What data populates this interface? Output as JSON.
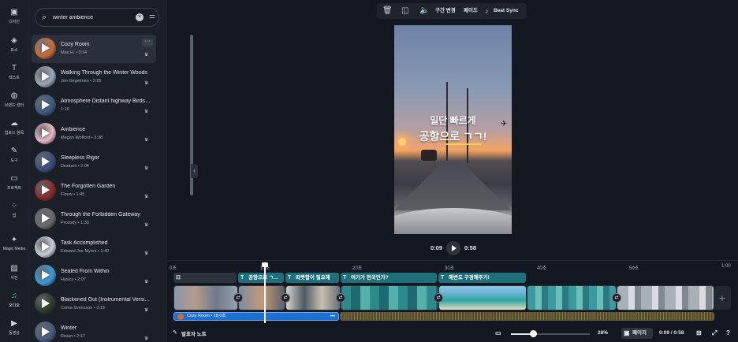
{
  "rail": [
    {
      "label": "디자인",
      "icon": "layout-icon"
    },
    {
      "label": "요소",
      "icon": "elements-icon"
    },
    {
      "label": "텍스트",
      "icon": "text-icon"
    },
    {
      "label": "브랜드 센터",
      "icon": "brand-icon"
    },
    {
      "label": "업로드 항목",
      "icon": "upload-icon"
    },
    {
      "label": "도구",
      "icon": "draw-icon"
    },
    {
      "label": "프로젝트",
      "icon": "folder-icon"
    },
    {
      "label": "앱",
      "icon": "apps-icon"
    },
    {
      "label": "Magic Media",
      "icon": "magic-media-icon"
    },
    {
      "label": "사진",
      "icon": "photo-icon"
    },
    {
      "label": "오디오",
      "icon": "audio-icon"
    },
    {
      "label": "동영상",
      "icon": "video-icon"
    }
  ],
  "search": {
    "value": "winter ambience"
  },
  "tracks": [
    {
      "title": "Cozy Room",
      "meta": "Max H. • 3:14",
      "color": "#c96b38"
    },
    {
      "title": "Walking Through the Winter Woods",
      "meta": "Jon Gegelman • 2:25",
      "color": "#9aa6b5"
    },
    {
      "title": "Atmosphere Distant highway Birds…",
      "meta": "1:19",
      "color": "#3d5a80"
    },
    {
      "title": "Ambience",
      "meta": "Megan Wofford • 3:38",
      "color": "#e8b6c4"
    },
    {
      "title": "Sleepless Rigor",
      "meta": "Deskant • 2:04",
      "color": "#3a4e7a"
    },
    {
      "title": "The Forgotten Garden",
      "meta": "Flouw • 1:45",
      "color": "#8a2a2a"
    },
    {
      "title": "Through the Forbidden Gateway",
      "meta": "Prozody • 1:33",
      "color": "#6a6a6a"
    },
    {
      "title": "Task Accomplished",
      "meta": "Edward Joe Myers • 1:40",
      "color": "#c8ccd4"
    },
    {
      "title": "Sealed From Within",
      "meta": "Hysics • 2:07",
      "color": "#3a9ad8"
    },
    {
      "title": "Blackened Out (Instrumental Versi…",
      "meta": "Coma Svensson • 3:15",
      "color": "#2a3a2a"
    },
    {
      "title": "Winter",
      "meta": "Risian • 2:17",
      "color": "#4a5a7a"
    }
  ],
  "toolbar": {
    "segment": "구간 변경",
    "fade": "페이드",
    "beat_sync": "Beat Sync"
  },
  "canvas": {
    "caption_line1": "일단 빠르게",
    "caption_line2": "공항으로 ㄱㄱ!"
  },
  "player": {
    "current": "0:09",
    "total": "0:58"
  },
  "ruler": [
    "0초",
    "10초",
    "20초",
    "30초",
    "40초",
    "50초",
    "1:00"
  ],
  "text_clips": [
    "",
    "공항으로 ㄱ…",
    "따뜻함이 필요해",
    "여기가 천국인가?",
    "해변도 구경해주기!"
  ],
  "audio_clip": {
    "label": "Cozy Room • 18.0초"
  },
  "footer": {
    "notes": "발표자 노트",
    "zoom": "28%",
    "page_view": "페이지",
    "time": "0:09 / 0:58",
    "zoom_level": 0.28
  }
}
